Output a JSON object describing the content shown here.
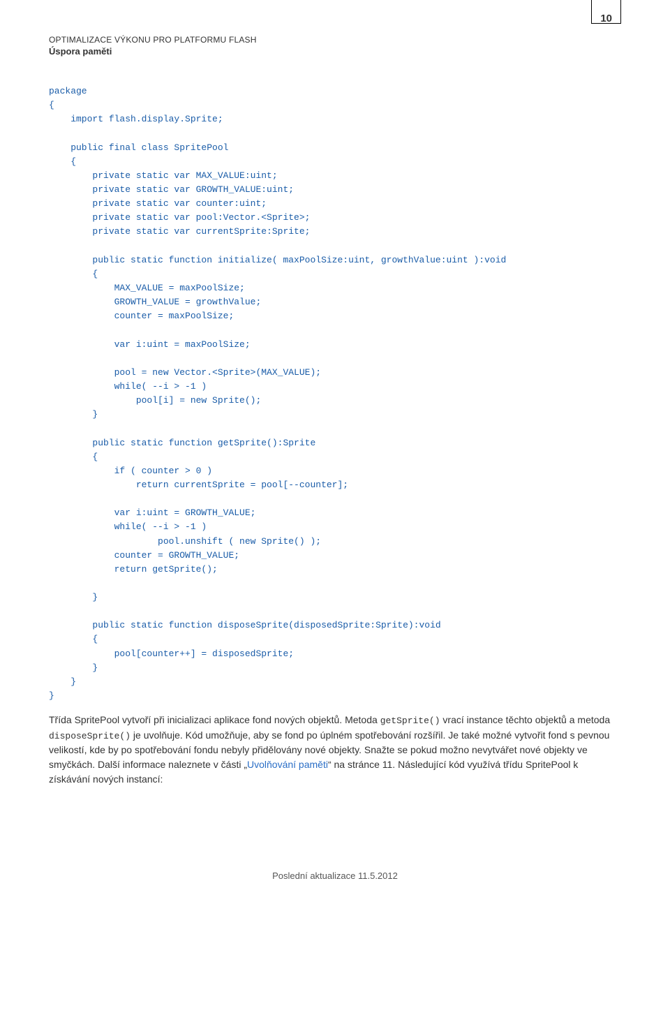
{
  "header": {
    "doc_title": "OPTIMALIZACE VÝKONU PRO PLATFORMU FLASH",
    "section": "Úspora paměti",
    "page_number": "10"
  },
  "code": "package\n{\n    import flash.display.Sprite;\n    \n    public final class SpritePool\n    {\n        private static var MAX_VALUE:uint;\n        private static var GROWTH_VALUE:uint;\n        private static var counter:uint;\n        private static var pool:Vector.<Sprite>;\n        private static var currentSprite:Sprite;\n        \n        public static function initialize( maxPoolSize:uint, growthValue:uint ):void\n        {\n            MAX_VALUE = maxPoolSize;\n            GROWTH_VALUE = growthValue;\n            counter = maxPoolSize;\n            \n            var i:uint = maxPoolSize;\n            \n            pool = new Vector.<Sprite>(MAX_VALUE);\n            while( --i > -1 )\n                pool[i] = new Sprite();\n        }\n        \n        public static function getSprite():Sprite\n        {\n            if ( counter > 0 )\n                return currentSprite = pool[--counter];\n                \n            var i:uint = GROWTH_VALUE;\n            while( --i > -1 )\n                    pool.unshift ( new Sprite() );\n            counter = GROWTH_VALUE;\n            return getSprite();\n            \n        }\n        \n        public static function disposeSprite(disposedSprite:Sprite):void\n        {\n            pool[counter++] = disposedSprite;\n        }\n    }\n}",
  "body": {
    "p1_a": "Třída SpritePool vytvoří při inicializaci aplikace fond nových objektů. Metoda ",
    "p1_code1": "getSprite()",
    "p1_b": " vrací instance těchto objektů a metoda ",
    "p1_code2": "disposeSprite()",
    "p1_c": " je uvolňuje. Kód umožňuje, aby se fond po úplném spotřebování rozšířil. Je také možné vytvořit fond s pevnou velikostí, kde by po spotřebování fondu nebyly přidělovány nové objekty. Snažte se pokud možno nevytvářet nové objekty ve smyčkách. Další informace naleznete v části „",
    "p1_link": "Uvolňování paměti",
    "p1_d": "“ na stránce 11. Následující kód využívá třídu SpritePool k získávání nových instancí:"
  },
  "footer": {
    "updated": "Poslední aktualizace 11.5.2012"
  }
}
